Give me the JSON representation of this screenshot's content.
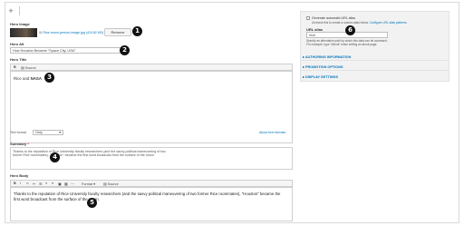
{
  "topbar": {
    "add_label": "+"
  },
  "hero_image": {
    "label": "Hero Image",
    "file_link": "Rice-moon-person-image.jpg (410.82 KB)",
    "remove_label": "Remove"
  },
  "hero_alt": {
    "label": "Hero Alt",
    "value": "How Houston Became \"Space City, USA\""
  },
  "hero_title": {
    "label": "Hero Title",
    "source_label": "Source",
    "bold_label": "B",
    "content_plain": "Rice and ",
    "content_bold": "NASA"
  },
  "text_format": {
    "label": "Text format",
    "value": "Only",
    "help_link": "About text formats"
  },
  "summary": {
    "label": "Summary",
    "required_mark": "*",
    "value": "Thanks to the reputation of Rice University faculty researchers (and the savvy political maneuvering of two former Rice roommates), \"Houston\" became the first word broadcast from the surface of the moon."
  },
  "hero_body": {
    "label": "Hero Body",
    "format_label": "Format",
    "source_label": "Source",
    "content": "Thanks to the reputation of Rice University faculty researchers (and the savvy political maneuvering of two former Rice roommates), \"Houston\" became the first word broadcast from the surface of the moon."
  },
  "sidebar": {
    "auto_alias_label": "Generate automatic URL alias",
    "auto_alias_help": "Uncheck this to create a custom alias below.",
    "auto_alias_link": "Configure URL alias patterns.",
    "url_alias_label": "URL alias",
    "url_alias_value": "/rice",
    "url_alias_help": "Specify an alternative path by which this data can be accessed. For example, type \"/about\" when writing an about page.",
    "sections": [
      "AUTHORING INFORMATION",
      "PROMOTION OPTIONS",
      "DISPLAY SETTINGS"
    ]
  },
  "callouts": [
    "1",
    "2",
    "3",
    "4",
    "5",
    "6"
  ],
  "colors": {
    "accent": "#0074bd",
    "badge": "#111111"
  }
}
